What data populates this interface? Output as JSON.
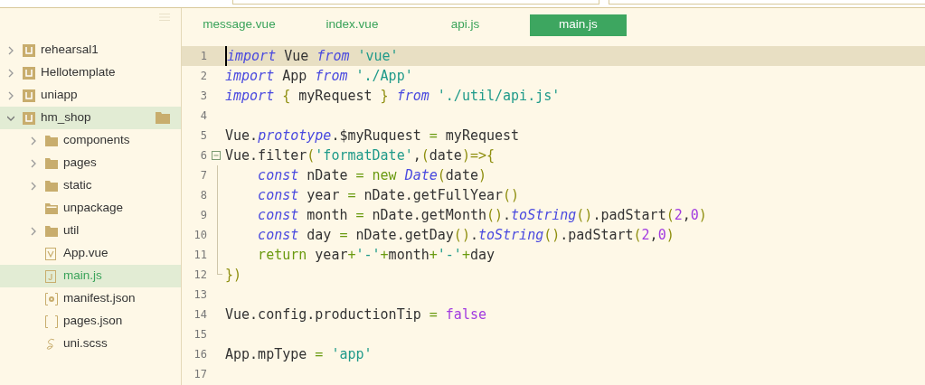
{
  "sidebar": {
    "items": [
      {
        "label": "rehearsal1",
        "kind": "project",
        "expanded": false,
        "selected": false,
        "highlighted": false
      },
      {
        "label": "Hellotemplate",
        "kind": "project",
        "expanded": false,
        "selected": false,
        "highlighted": false
      },
      {
        "label": "uniapp",
        "kind": "project",
        "expanded": false,
        "selected": false,
        "highlighted": false
      },
      {
        "label": "hm_shop",
        "kind": "project",
        "expanded": true,
        "selected": false,
        "highlighted": true,
        "children": [
          {
            "label": "components",
            "kind": "folder",
            "expanded": false,
            "selected": false,
            "highlighted": false
          },
          {
            "label": "pages",
            "kind": "folder",
            "expanded": false,
            "selected": false,
            "highlighted": false
          },
          {
            "label": "static",
            "kind": "folder",
            "expanded": false,
            "selected": false,
            "highlighted": false
          },
          {
            "label": "unpackage",
            "kind": "folder-empty",
            "selected": false,
            "highlighted": false
          },
          {
            "label": "util",
            "kind": "folder",
            "expanded": false,
            "selected": false,
            "highlighted": false
          },
          {
            "label": "App.vue",
            "kind": "vue",
            "selected": false,
            "highlighted": false
          },
          {
            "label": "main.js",
            "kind": "js",
            "selected": true,
            "highlighted": true
          },
          {
            "label": "manifest.json",
            "kind": "settings-json",
            "selected": false,
            "highlighted": false
          },
          {
            "label": "pages.json",
            "kind": "json",
            "selected": false,
            "highlighted": false
          },
          {
            "label": "uni.scss",
            "kind": "scss",
            "selected": false,
            "highlighted": false
          }
        ]
      }
    ]
  },
  "tabs": [
    {
      "label": "message.vue",
      "selected": false
    },
    {
      "label": "index.vue",
      "selected": false
    },
    {
      "label": "api.js",
      "selected": false
    },
    {
      "label": "main.js",
      "selected": true
    }
  ],
  "editor": {
    "lines": [
      {
        "number": "1",
        "kind": "plain",
        "current": true,
        "tokens": [
          {
            "text": "import",
            "kind": "keyword"
          },
          {
            "text": " Vue ",
            "kind": "plain"
          },
          {
            "text": "from",
            "kind": "keyword"
          },
          {
            "text": " 'vue'",
            "kind": "string"
          }
        ]
      },
      {
        "number": "2",
        "kind": "plain",
        "current": false,
        "tokens": [
          {
            "text": "import",
            "kind": "keyword"
          },
          {
            "text": " App ",
            "kind": "plain"
          },
          {
            "text": "from",
            "kind": "keyword"
          },
          {
            "text": " './App'",
            "kind": "string"
          }
        ]
      },
      {
        "number": "3",
        "kind": "plain",
        "current": false,
        "tokens": [
          {
            "text": "import",
            "kind": "keyword"
          },
          {
            "text": " {",
            "kind": "brace"
          },
          {
            "text": " myRequest ",
            "kind": "plain"
          },
          {
            "text": "} ",
            "kind": "brace"
          },
          {
            "text": "from",
            "kind": "keyword"
          },
          {
            "text": " './util/api.js'",
            "kind": "string"
          }
        ]
      },
      {
        "number": "4",
        "kind": "plain",
        "current": false
      },
      {
        "number": "5",
        "kind": "plain",
        "current": false,
        "tokens": [
          {
            "text": "Vue.",
            "kind": "plain"
          },
          {
            "text": "prototype",
            "kind": "keyword"
          },
          {
            "text": ".$myRuquest ",
            "kind": "plain"
          },
          {
            "text": "=",
            "kind": "operator"
          },
          {
            "text": " myRequest",
            "kind": "plain"
          }
        ]
      },
      {
        "number": "6",
        "kind": "fold-start",
        "current": false,
        "tokens": [
          {
            "text": "Vue.filter",
            "kind": "plain"
          },
          {
            "text": "(",
            "kind": "brace"
          },
          {
            "text": "'formatDate'",
            "kind": "string"
          },
          {
            "text": ",",
            "kind": "plain"
          },
          {
            "text": "(",
            "kind": "brace"
          },
          {
            "text": "date",
            "kind": "plain"
          },
          {
            "text": ")=>{",
            "kind": "brace"
          }
        ]
      },
      {
        "number": "7",
        "kind": "fold-body",
        "current": false,
        "indented": true,
        "tokens": [
          {
            "text": "const",
            "kind": "keyword"
          },
          {
            "text": " nDate ",
            "kind": "plain"
          },
          {
            "text": "= new ",
            "kind": "operator"
          },
          {
            "text": "Date",
            "kind": "keyword"
          },
          {
            "text": "(",
            "kind": "brace"
          },
          {
            "text": "date",
            "kind": "plain"
          },
          {
            "text": ")",
            "kind": "brace"
          }
        ]
      },
      {
        "number": "8",
        "kind": "fold-body",
        "current": false,
        "indented": true,
        "tokens": [
          {
            "text": "const",
            "kind": "keyword"
          },
          {
            "text": " year ",
            "kind": "plain"
          },
          {
            "text": "=",
            "kind": "operator"
          },
          {
            "text": " nDate.getFullYear",
            "kind": "plain"
          },
          {
            "text": "()",
            "kind": "brace"
          }
        ]
      },
      {
        "number": "9",
        "kind": "fold-body",
        "current": false,
        "indented": true,
        "tokens": [
          {
            "text": "const",
            "kind": "keyword"
          },
          {
            "text": " month ",
            "kind": "plain"
          },
          {
            "text": "=",
            "kind": "operator"
          },
          {
            "text": " nDate.getMonth",
            "kind": "plain"
          },
          {
            "text": "()",
            "kind": "brace"
          },
          {
            "text": ".",
            "kind": "plain"
          },
          {
            "text": "toString",
            "kind": "keyword"
          },
          {
            "text": "()",
            "kind": "brace"
          },
          {
            "text": ".padStart",
            "kind": "plain"
          },
          {
            "text": "(",
            "kind": "brace"
          },
          {
            "text": "2",
            "kind": "literal"
          },
          {
            "text": ",",
            "kind": "plain"
          },
          {
            "text": "0",
            "kind": "literal"
          },
          {
            "text": ")",
            "kind": "brace"
          }
        ]
      },
      {
        "number": "10",
        "kind": "fold-body",
        "current": false,
        "indented": true,
        "tokens": [
          {
            "text": "const",
            "kind": "keyword"
          },
          {
            "text": " day ",
            "kind": "plain"
          },
          {
            "text": "=",
            "kind": "operator"
          },
          {
            "text": " nDate.getDay",
            "kind": "plain"
          },
          {
            "text": "()",
            "kind": "brace"
          },
          {
            "text": ".",
            "kind": "plain"
          },
          {
            "text": "toString",
            "kind": "keyword"
          },
          {
            "text": "()",
            "kind": "brace"
          },
          {
            "text": ".padStart",
            "kind": "plain"
          },
          {
            "text": "(",
            "kind": "brace"
          },
          {
            "text": "2",
            "kind": "literal"
          },
          {
            "text": ",",
            "kind": "plain"
          },
          {
            "text": "0",
            "kind": "literal"
          },
          {
            "text": ")",
            "kind": "brace"
          }
        ]
      },
      {
        "number": "11",
        "kind": "fold-body",
        "current": false,
        "indented": true,
        "tokens": [
          {
            "text": "return",
            "kind": "operator"
          },
          {
            "text": " year",
            "kind": "plain"
          },
          {
            "text": "+",
            "kind": "operator"
          },
          {
            "text": "'-'",
            "kind": "string"
          },
          {
            "text": "+",
            "kind": "operator"
          },
          {
            "text": "month",
            "kind": "plain"
          },
          {
            "text": "+",
            "kind": "operator"
          },
          {
            "text": "'-'",
            "kind": "string"
          },
          {
            "text": "+",
            "kind": "operator"
          },
          {
            "text": "day",
            "kind": "plain"
          }
        ]
      },
      {
        "number": "12",
        "kind": "fold-end",
        "current": false,
        "tokens": [
          {
            "text": "})",
            "kind": "brace"
          }
        ]
      },
      {
        "number": "13",
        "kind": "plain",
        "current": false
      },
      {
        "number": "14",
        "kind": "plain",
        "current": false,
        "tokens": [
          {
            "text": "Vue.config.productionTip ",
            "kind": "plain"
          },
          {
            "text": "=",
            "kind": "operator"
          },
          {
            "text": " false",
            "kind": "literal"
          }
        ]
      },
      {
        "number": "15",
        "kind": "plain",
        "current": false
      },
      {
        "number": "16",
        "kind": "plain",
        "current": false,
        "tokens": [
          {
            "text": "App.mpType ",
            "kind": "plain"
          },
          {
            "text": "=",
            "kind": "operator"
          },
          {
            "text": " 'app'",
            "kind": "string"
          }
        ]
      },
      {
        "number": "17",
        "kind": "plain",
        "current": false
      }
    ]
  }
}
